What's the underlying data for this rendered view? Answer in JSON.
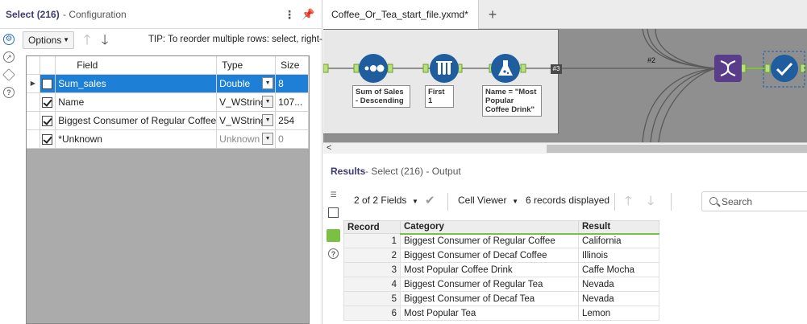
{
  "config_panel": {
    "title": "Select (216)",
    "subtitle": "- Configuration",
    "menu_icon": "vertical-ellipsis-icon",
    "pin_icon": "pin-icon",
    "options_label": "Options",
    "tip": "TIP: To reorder multiple rows: select, right-c",
    "columns": {
      "field": "Field",
      "type": "Type",
      "size": "Size"
    },
    "rows": [
      {
        "checked": false,
        "selected": true,
        "field": "Sum_sales",
        "type": "Double",
        "size": "8",
        "dim": false
      },
      {
        "checked": true,
        "selected": false,
        "field": "Name",
        "type": "V_WString",
        "size": "107...",
        "dim": false
      },
      {
        "checked": true,
        "selected": false,
        "field": "Biggest Consumer of Regular Coffee",
        "type": "V_WString",
        "size": "254",
        "dim": false
      },
      {
        "checked": true,
        "selected": false,
        "field": "*Unknown",
        "type": "Unknown",
        "size": "0",
        "dim": true
      }
    ]
  },
  "tabs": {
    "active_label": "Coffee_Or_Tea_start_file.yxmd*",
    "add_label": "+"
  },
  "canvas": {
    "tools": [
      {
        "name": "sort-tool",
        "label": "Sum of Sales - Descending",
        "color": "#1f5d9e"
      },
      {
        "name": "sample-tool",
        "label": "First 1",
        "color": "#1f5d9e"
      },
      {
        "name": "formula-tool",
        "label": "Name = \"Most Popular Coffee Drink\"",
        "color": "#1f5d9e"
      },
      {
        "name": "transpose-tool",
        "label": "",
        "color": "#5a3d8a"
      },
      {
        "name": "select-tool",
        "label": "",
        "color": "#1f5d9e"
      }
    ],
    "connection_3": "#3",
    "connection_2": "#2"
  },
  "results": {
    "title": "Results",
    "subtitle": "- Select (216) - Output",
    "fields_label": "2 of 2 Fields",
    "viewer_label": "Cell Viewer",
    "records_label": "6 records displayed",
    "search_placeholder": "Search",
    "columns": {
      "record": "Record",
      "category": "Category",
      "result": "Result"
    },
    "rows": [
      {
        "record": "1",
        "category": "Biggest Consumer of Regular Coffee",
        "result": "California"
      },
      {
        "record": "2",
        "category": "Biggest Consumer of Decaf Coffee",
        "result": "Illinois"
      },
      {
        "record": "3",
        "category": "Most Popular Coffee Drink",
        "result": "Caffe Mocha"
      },
      {
        "record": "4",
        "category": "Biggest Consumer of Regular Tea",
        "result": "Nevada"
      },
      {
        "record": "5",
        "category": "Biggest Consumer of Decaf Tea",
        "result": "Nevada"
      },
      {
        "record": "6",
        "category": "Most Popular Tea",
        "result": "Lemon"
      }
    ]
  },
  "colors": {
    "selection": "#1e7fd6",
    "accent_green": "#7ac143",
    "canvas_bg": "#8f8f8f",
    "title_purple": "#3b3b6e"
  }
}
